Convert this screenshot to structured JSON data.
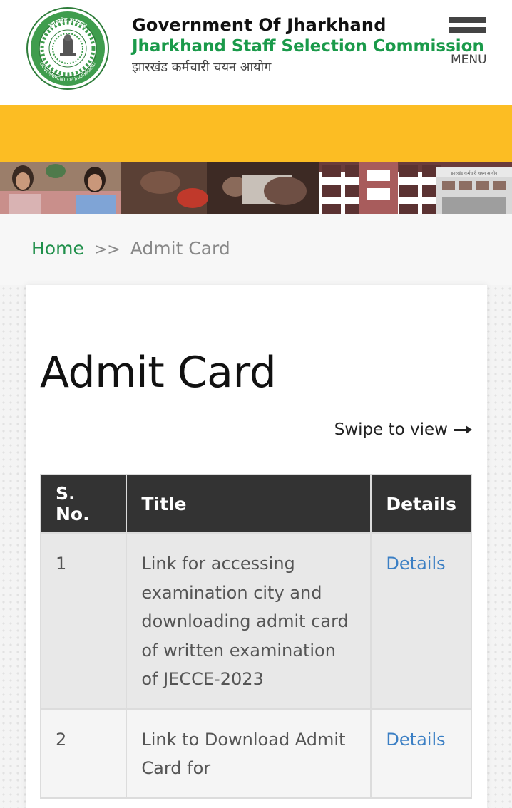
{
  "header": {
    "gov_title": "Government Of Jharkhand",
    "org_title": "Jharkhand Staff Selection Commission",
    "hindi_title": "झारखंड कर्मचारी चयन आयोग",
    "menu_label": "MENU",
    "logo_icon": "jharkhand-emblem-logo",
    "logo_text": "झारखंड सरकार GOVERNMENT OF JHARKHAND"
  },
  "colors": {
    "accent_green": "#1a9a4a",
    "band_yellow": "#fcbd23",
    "table_header": "#333333",
    "link_blue": "#3b7fc4"
  },
  "banner": {
    "sign_text": "झारखंड कर्मचारी चयन आयोग"
  },
  "breadcrumb": {
    "home": "Home",
    "separator": ">>",
    "current": "Admit Card"
  },
  "main": {
    "title": "Admit Card",
    "swipe_hint": "Swipe to view",
    "table": {
      "headers": [
        "S. No.",
        "Title",
        "Details"
      ],
      "rows": [
        {
          "sno": "1",
          "title": "Link for accessing examination city and downloading admit card of written examination of JECCE-2023",
          "details": "Details"
        },
        {
          "sno": "2",
          "title": "Link to Download Admit Card for",
          "details": "Details"
        }
      ]
    }
  }
}
